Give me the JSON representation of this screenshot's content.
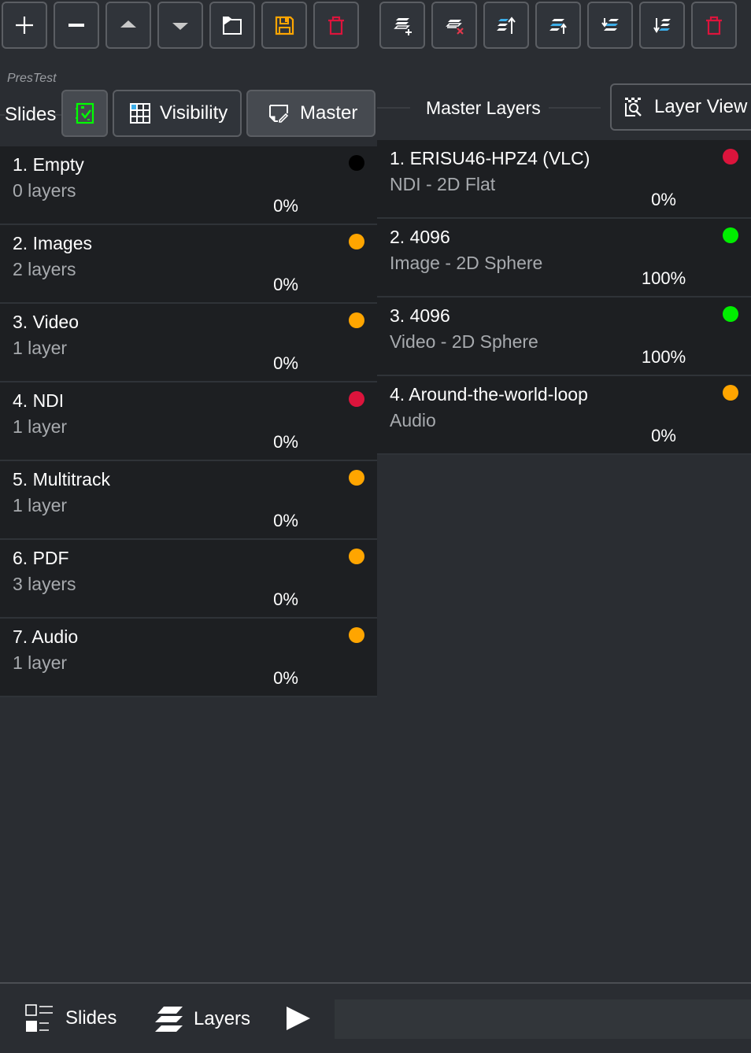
{
  "toolbar": {
    "left_buttons": [
      {
        "name": "add-slide",
        "icon": "plus-icon"
      },
      {
        "name": "remove-slide",
        "icon": "minus-icon"
      },
      {
        "name": "move-slide-up",
        "icon": "triangle-up-icon"
      },
      {
        "name": "move-slide-down",
        "icon": "triangle-down-icon"
      },
      {
        "name": "open-presentation",
        "icon": "folder-icon"
      },
      {
        "name": "save-presentation",
        "icon": "floppy-icon"
      },
      {
        "name": "delete-slide",
        "icon": "trash-icon"
      }
    ],
    "right_buttons": [
      {
        "name": "add-layer",
        "icon": "layers-add-icon"
      },
      {
        "name": "remove-layer",
        "icon": "layers-remove-icon"
      },
      {
        "name": "move-layer-top",
        "icon": "layers-top-icon"
      },
      {
        "name": "move-layer-up",
        "icon": "layers-up-icon"
      },
      {
        "name": "move-layer-down",
        "icon": "layers-down-icon"
      },
      {
        "name": "move-layer-bottom",
        "icon": "layers-bottom-icon"
      },
      {
        "name": "delete-layer",
        "icon": "trash-icon"
      }
    ]
  },
  "colors": {
    "red": "#dc143c",
    "orange": "#ffa500",
    "green": "#00ee00",
    "black": "#000000",
    "accent_blue": "#3daee9",
    "save_orange": "#ffa500",
    "check_green": "#00ff00"
  },
  "slides_panel": {
    "presentation_name": "PresTest",
    "label": "Slides",
    "visibility_button": "Visibility",
    "master_button": "Master",
    "slides": [
      {
        "title": "1. Empty",
        "subtitle": "0 layers",
        "percent": "0%",
        "status": "black"
      },
      {
        "title": "2. Images",
        "subtitle": "2 layers",
        "percent": "0%",
        "status": "orange"
      },
      {
        "title": "3. Video",
        "subtitle": "1 layer",
        "percent": "0%",
        "status": "orange"
      },
      {
        "title": "4. NDI",
        "subtitle": "1 layer",
        "percent": "0%",
        "status": "red"
      },
      {
        "title": "5. Multitrack",
        "subtitle": "1 layer",
        "percent": "0%",
        "status": "orange"
      },
      {
        "title": "6. PDF",
        "subtitle": "3 layers",
        "percent": "0%",
        "status": "orange"
      },
      {
        "title": "7. Audio",
        "subtitle": "1 layer",
        "percent": "0%",
        "status": "orange"
      }
    ]
  },
  "layers_panel": {
    "label": "Master Layers",
    "layer_view_button": "Layer View",
    "layers": [
      {
        "title": "1. ERISU46-HPZ4 (VLC)",
        "subtitle": "NDI - 2D Flat",
        "percent": "0%",
        "status": "red"
      },
      {
        "title": "2. 4096",
        "subtitle": "Image - 2D Sphere",
        "percent": "100%",
        "status": "green"
      },
      {
        "title": "3. 4096",
        "subtitle": "Video - 2D Sphere",
        "percent": "100%",
        "status": "green"
      },
      {
        "title": "4. Around-the-world-loop",
        "subtitle": "Audio",
        "percent": "0%",
        "status": "orange"
      }
    ]
  },
  "bottom_nav": {
    "slides_label": "Slides",
    "layers_label": "Layers"
  }
}
